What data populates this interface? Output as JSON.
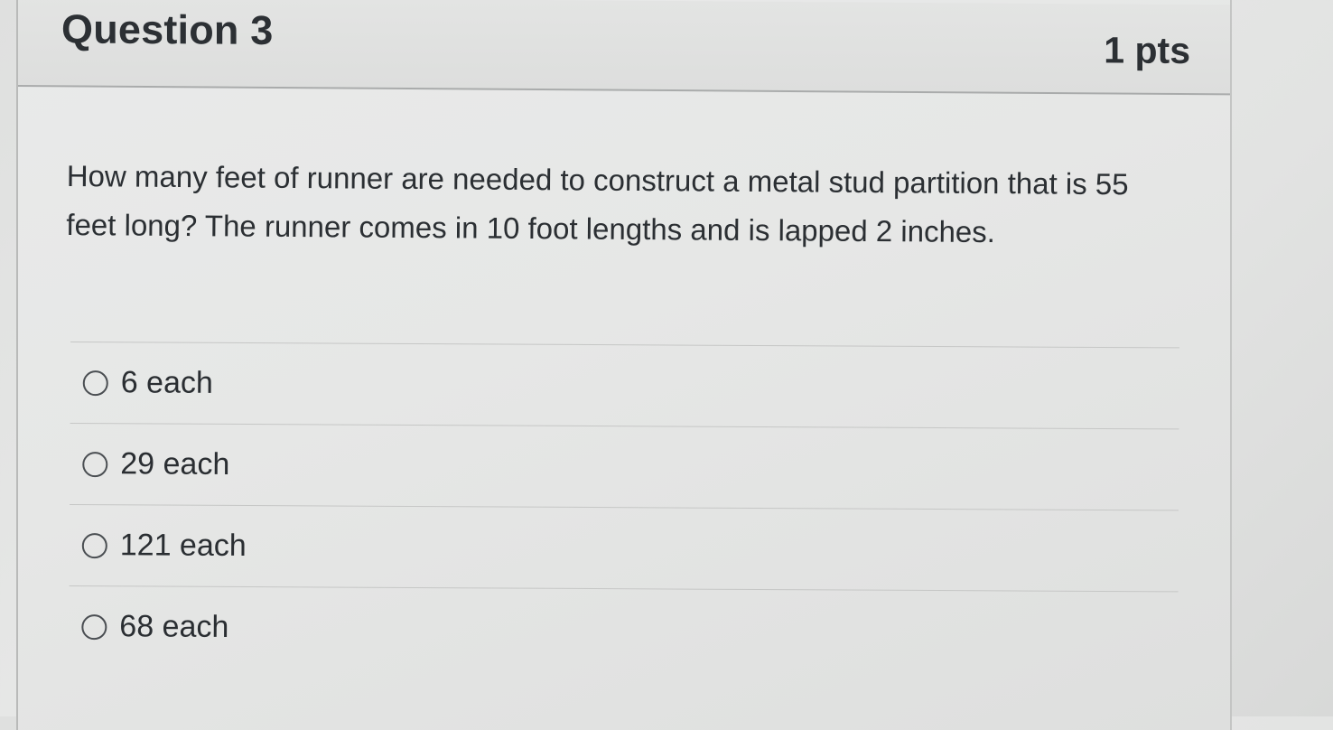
{
  "question": {
    "title": "Question 3",
    "points": "1 pts",
    "text": "How many feet of runner are needed to construct a metal stud partition that is 55 feet long?  The runner comes in 10 foot lengths and is lapped 2 inches.",
    "answers": [
      {
        "label": "6 each"
      },
      {
        "label": "29 each"
      },
      {
        "label": "121 each"
      },
      {
        "label": "68 each"
      }
    ]
  }
}
